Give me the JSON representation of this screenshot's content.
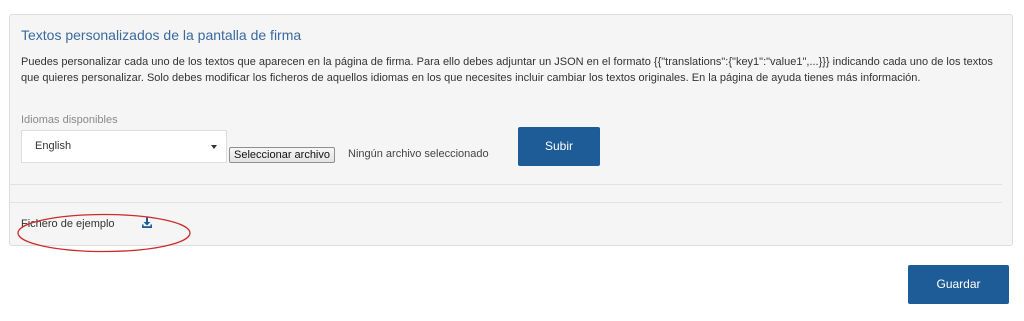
{
  "panel": {
    "title": "Textos personalizados de la pantalla de firma",
    "description": "Puedes personalizar cada uno de los textos que aparecen en la página de firma. Para ello debes adjuntar un JSON en el formato {{\"translations\":{\"key1\":\"value1\",...}}} indicando cada uno de los textos que quieres personalizar. Solo debes modificar los ficheros de aquellos idiomas en los que necesites incluir cambiar los textos originales. En la página de ayuda tienes más información.",
    "language_label": "Idiomas disponibles",
    "language_selected": "English",
    "file_button_label": "Seleccionar archivo",
    "file_status": "Ningún archivo seleccionado",
    "upload_label": "Subir",
    "sample_file_label": "Fichero de ejemplo",
    "sample_file_icon": "download-icon"
  },
  "footer": {
    "save_label": "Guardar"
  },
  "colors": {
    "accent": "#1d5c96",
    "title": "#3a6a9e",
    "annotation": "#cc2b2b",
    "panel_bg": "#f5f5f5"
  }
}
